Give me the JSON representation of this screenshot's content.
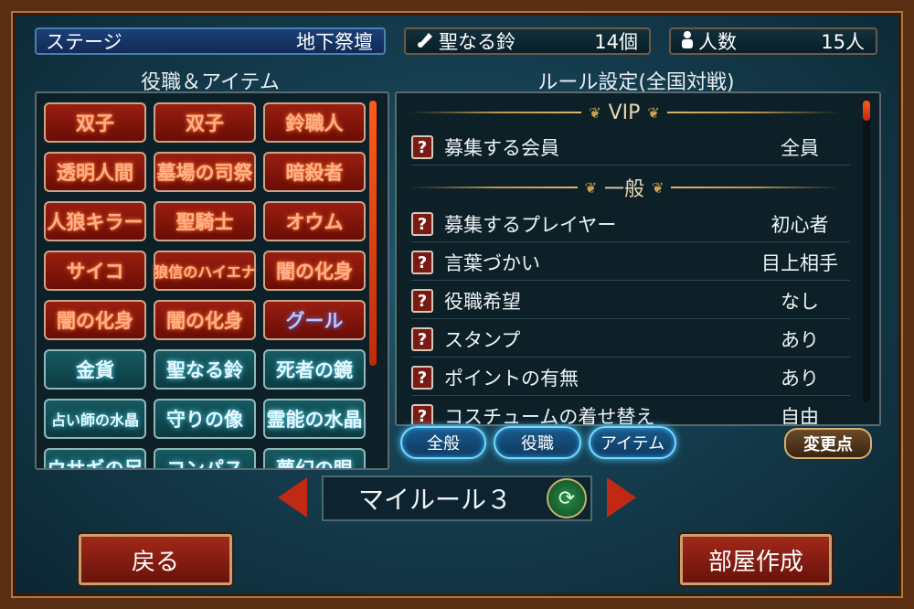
{
  "top": {
    "stage_label": "ステージ",
    "stage_value": "地下祭壇",
    "bell_label": "聖なる鈴",
    "bell_value": "14個",
    "people_label": "人数",
    "people_value": "15人"
  },
  "left": {
    "title": "役職＆アイテム",
    "tiles": [
      {
        "label": "双子",
        "style": "red"
      },
      {
        "label": "双子",
        "style": "red"
      },
      {
        "label": "鈴職人",
        "style": "red"
      },
      {
        "label": "透明人間",
        "style": "red"
      },
      {
        "label": "墓場の司祭",
        "style": "red"
      },
      {
        "label": "暗殺者",
        "style": "red"
      },
      {
        "label": "人狼キラー",
        "style": "red"
      },
      {
        "label": "聖騎士",
        "style": "red"
      },
      {
        "label": "オウム",
        "style": "red"
      },
      {
        "label": "サイコ",
        "style": "red"
      },
      {
        "label": "狼信のハイエナ",
        "style": "red"
      },
      {
        "label": "闇の化身",
        "style": "red"
      },
      {
        "label": "闇の化身",
        "style": "red"
      },
      {
        "label": "闇の化身",
        "style": "red"
      },
      {
        "label": "グール",
        "style": "red"
      },
      {
        "label": "金貨",
        "style": "teal"
      },
      {
        "label": "聖なる鈴",
        "style": "teal"
      },
      {
        "label": "死者の鏡",
        "style": "teal"
      },
      {
        "label": "占い師の水晶",
        "style": "teal"
      },
      {
        "label": "守りの像",
        "style": "teal"
      },
      {
        "label": "霊能の水晶",
        "style": "teal"
      },
      {
        "label": "ウサギの足",
        "style": "teal"
      },
      {
        "label": "コンパス",
        "style": "teal"
      },
      {
        "label": "夢幻の眼",
        "style": "teal"
      }
    ]
  },
  "right": {
    "title": "ルール設定(全国対戦)",
    "section_vip": "VIP",
    "section_general": "一般",
    "q_glyph": "?",
    "rows": [
      {
        "label": "募集する会員",
        "value": "全員"
      },
      {
        "label": "募集するプレイヤー",
        "value": "初心者"
      },
      {
        "label": "言葉づかい",
        "value": "目上相手"
      },
      {
        "label": "役職希望",
        "value": "なし"
      },
      {
        "label": "スタンプ",
        "value": "あり"
      },
      {
        "label": "ポイントの有無",
        "value": "あり"
      },
      {
        "label": "コスチュームの着せ替え",
        "value": "自由"
      }
    ]
  },
  "tabs": {
    "general": "全般",
    "roles": "役職",
    "items": "アイテム",
    "changes": "変更点"
  },
  "rule_selector": {
    "name": "マイルール３",
    "refresh_glyph": "⟳"
  },
  "buttons": {
    "back": "戻る",
    "create_room": "部屋作成"
  }
}
